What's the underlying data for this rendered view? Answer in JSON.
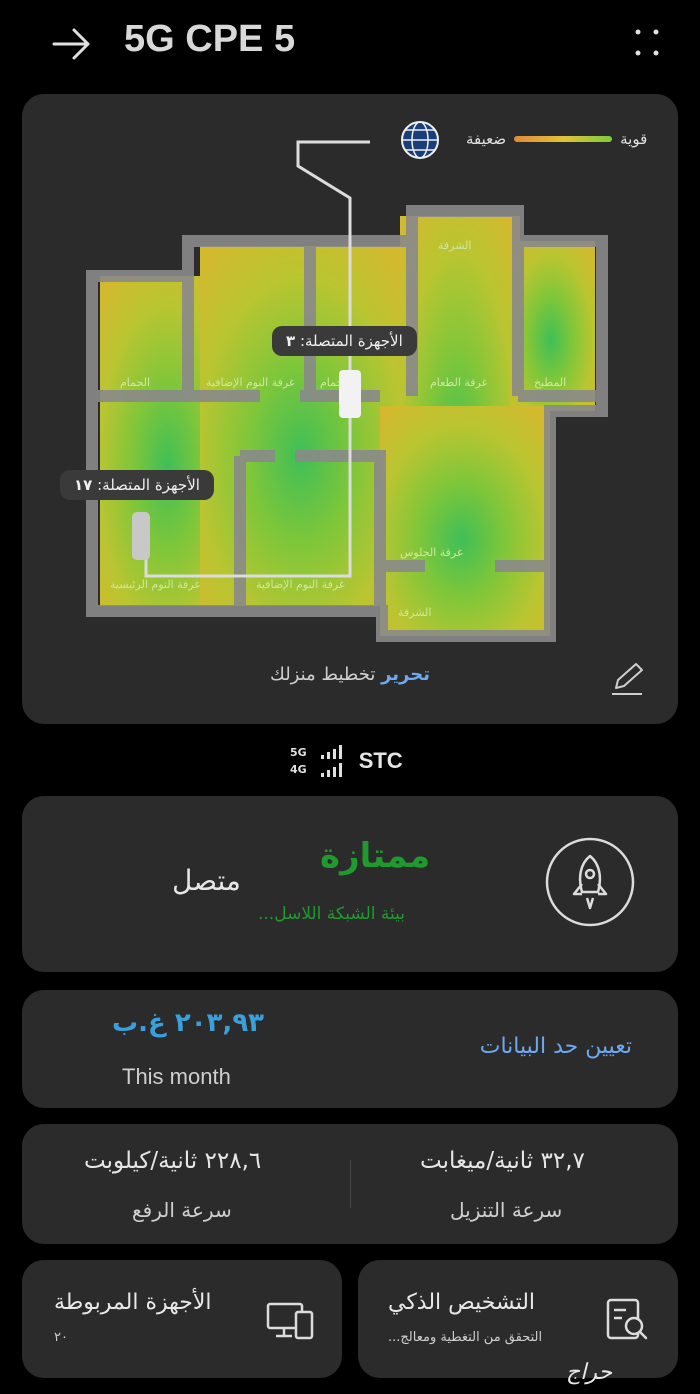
{
  "header": {
    "title": "5G CPE 5"
  },
  "map": {
    "legend_strong": "قوية",
    "legend_weak": "ضعيفة",
    "rooms": {
      "balcony_top": "الشرفة",
      "bathroom": "الحمام",
      "guest_room_top": "غرفة النوم الإضافية",
      "bathroom_mid": "الحمام",
      "dining": "غرفة الطعام",
      "kitchen": "المطبخ",
      "master_bedroom": "غرفة النوم الرئيسية",
      "guest_room_bottom": "غرفة النوم الإضافية",
      "living": "غرفة الجلوس",
      "balcony_bottom": "الشرفة"
    },
    "router_tip": {
      "label": "الأجهزة المتصلة:",
      "count": "٣"
    },
    "satellite_tip": {
      "label": "الأجهزة المتصلة:",
      "count": "١٧"
    },
    "edit_link": "تحرير",
    "edit_text": "تخطيط منزلك"
  },
  "signal": {
    "tech_top": "5G",
    "tech_bottom": "4G",
    "carrier": "STC"
  },
  "status": {
    "quality": "ممتازة",
    "environment": "بيئة الشبكة اللاسل...",
    "connection": "متصل",
    "colors": {
      "good": "#1f9a2e"
    }
  },
  "usage": {
    "value": "٢٠٣,٩٣ غ.ب",
    "period": "This month",
    "set_limit": "تعيين حد البيانات"
  },
  "speed": {
    "upload_value": "٢٢٨,٦ ثانية/كيلوبت",
    "upload_label": "سرعة الرفع",
    "download_value": "٣٢,٧ ثانية/ميغابت",
    "download_label": "سرعة التنزيل"
  },
  "tiles": {
    "devices_title": "الأجهزة المربوطة",
    "devices_count": "٢٠",
    "diag_title": "التشخيص الذكي",
    "diag_sub": "التحقق من التغطية ومعالج..."
  },
  "watermark": "حراج"
}
